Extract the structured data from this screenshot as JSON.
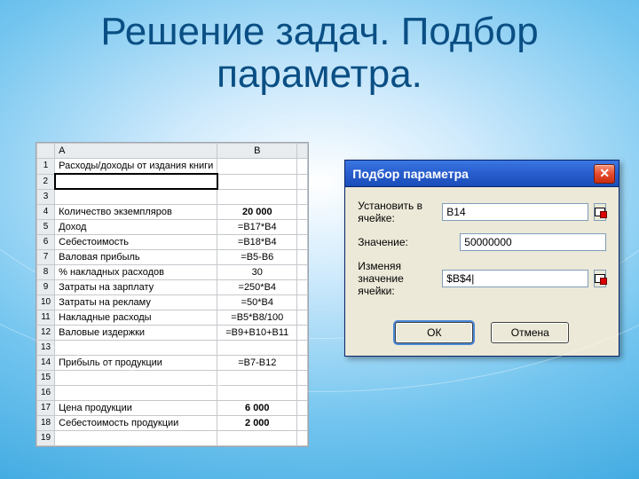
{
  "title_line1": "Решение задач. Подбор",
  "title_line2": "параметра.",
  "sheet": {
    "colA": "A",
    "colB": "B",
    "rows": [
      {
        "n": "1",
        "a": "Расходы/доходы от издания книги",
        "b": ""
      },
      {
        "n": "2",
        "a": "",
        "b": ""
      },
      {
        "n": "3",
        "a": "",
        "b": ""
      },
      {
        "n": "4",
        "a": "Количество экземпляров",
        "b": "20 000"
      },
      {
        "n": "5",
        "a": "Доход",
        "b": "=B17*B4"
      },
      {
        "n": "6",
        "a": "Себестоимость",
        "b": "=B18*B4"
      },
      {
        "n": "7",
        "a": "Валовая прибыль",
        "b": "=B5-B6"
      },
      {
        "n": "8",
        "a": "% накладных расходов",
        "b": "30"
      },
      {
        "n": "9",
        "a": "Затраты на зарплату",
        "b": "=250*B4"
      },
      {
        "n": "10",
        "a": "Затраты на рекламу",
        "b": "=50*B4"
      },
      {
        "n": "11",
        "a": "Накладные расходы",
        "b": "=B5*B8/100"
      },
      {
        "n": "12",
        "a": "Валовые издержки",
        "b": "=B9+B10+B11"
      },
      {
        "n": "13",
        "a": "",
        "b": ""
      },
      {
        "n": "14",
        "a": "Прибыль от продукции",
        "b": "=B7-B12"
      },
      {
        "n": "15",
        "a": "",
        "b": ""
      },
      {
        "n": "16",
        "a": "",
        "b": ""
      },
      {
        "n": "17",
        "a": "Цена продукции",
        "b": "6 000"
      },
      {
        "n": "18",
        "a": "Себестоимость продукции",
        "b": "2 000"
      },
      {
        "n": "19",
        "a": "",
        "b": ""
      }
    ]
  },
  "dialog": {
    "title": "Подбор параметра",
    "label_setcell": "Установить в ячейке:",
    "label_value": "Значение:",
    "label_changing": "Изменяя значение ячейки:",
    "val_setcell": "B14",
    "val_value": "50000000",
    "val_changing": "$B$4|",
    "ok": "ОК",
    "cancel": "Отмена"
  }
}
